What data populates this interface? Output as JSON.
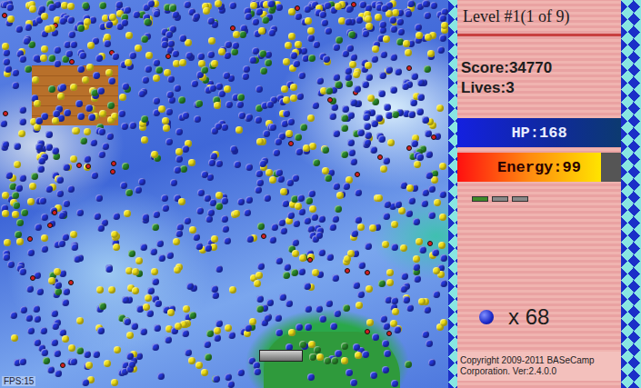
{
  "panel": {
    "level": "Level #1(1 of 9)",
    "score": "Score:34770",
    "lives": "Lives:3",
    "hp": {
      "label": "HP:168",
      "level": 1
    },
    "energy": {
      "label": "Energy:99",
      "level": 0.88
    },
    "reserve_paddles": [
      {
        "kind": "powered"
      },
      {
        "kind": "plain"
      },
      {
        "kind": "plain"
      }
    ],
    "ball_count": "x 68",
    "copyright": "Copyright 2009-2011 BASeCamp Corporation. Ver:2.4.0.0"
  },
  "playfield": {
    "fps": "FPS:15",
    "ball_colors": [
      "#2436d8",
      "#f2e21a",
      "#2b8c2e",
      "#d42020"
    ]
  }
}
